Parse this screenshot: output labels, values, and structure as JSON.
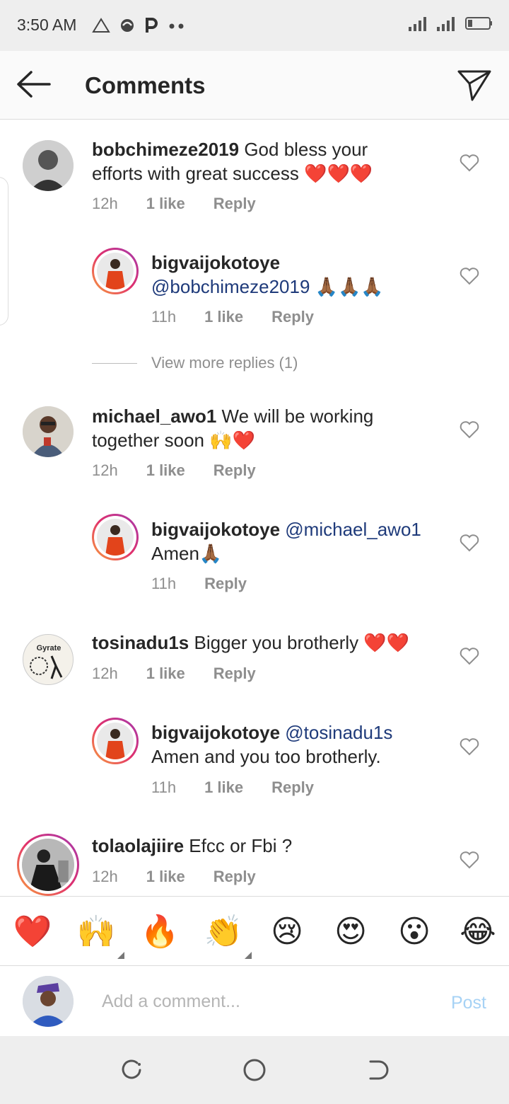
{
  "status": {
    "time": "3:50 AM",
    "left_icons": [
      "warning-triangle-icon",
      "swirl-icon",
      "p-app-icon",
      "more-dots-icon"
    ]
  },
  "header": {
    "title": "Comments"
  },
  "comments": [
    {
      "username": "bobchimeze2019",
      "text": "God bless your",
      "text2": "efforts with great success",
      "emoji": "❤️❤️❤️",
      "time": "12h",
      "likes": "1 like",
      "reply": "Reply"
    },
    {
      "username": "bigvaijokotoye",
      "mention": "@bobchimeze2019",
      "emoji": "🙏🏾🙏🏾🙏🏾",
      "time": "11h",
      "likes": "1 like",
      "reply": "Reply"
    },
    {
      "username": "michael_awo1",
      "text": "We will be working",
      "text2": "together soon",
      "emoji": "🙌❤️",
      "time": "12h",
      "likes": "1 like",
      "reply": "Reply"
    },
    {
      "username": "bigvaijokotoye",
      "mention": "@michael_awo1",
      "text2": "Amen",
      "emoji": "🙏🏾",
      "time": "11h",
      "reply": "Reply"
    },
    {
      "username": "tosinadu1s",
      "text": "Bigger you brotherly",
      "emoji": "❤️❤️",
      "time": "12h",
      "likes": "1 like",
      "reply": "Reply",
      "avatar_text": "Gyrate"
    },
    {
      "username": "bigvaijokotoye",
      "mention": "@tosinadu1s",
      "text2": "Amen and you too brotherly.",
      "time": "11h",
      "likes": "1 like",
      "reply": "Reply"
    },
    {
      "username": "tolaolajiire",
      "text": "Efcc or Fbi ?",
      "time": "12h",
      "likes": "1 like",
      "reply": "Reply"
    }
  ],
  "view_more": "View more replies (1)",
  "emoji_bar": [
    "❤️",
    "🙌",
    "🔥",
    "👏",
    "😢",
    "😍",
    "😮",
    "😂"
  ],
  "add_comment": {
    "placeholder": "Add a comment...",
    "post": "Post"
  },
  "colors": {
    "mention": "#1e3a7a",
    "post": "#a6d2f5",
    "meta": "#8e8e8e"
  }
}
